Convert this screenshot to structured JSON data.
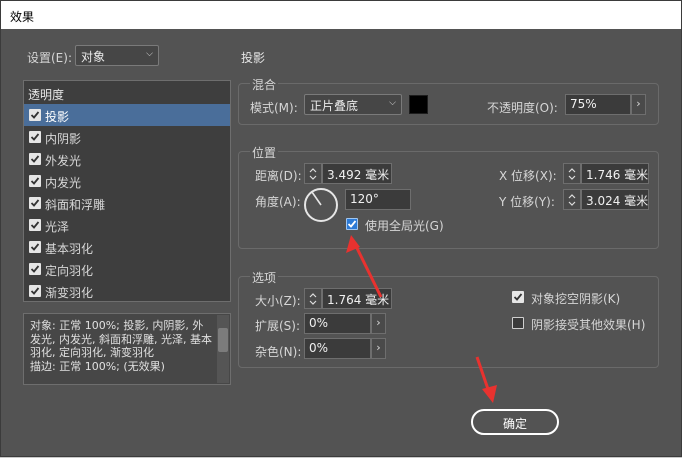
{
  "window": {
    "title": "效果"
  },
  "settings": {
    "label": "设置(E):",
    "value": "对象"
  },
  "left": {
    "header": "透明度",
    "items": [
      {
        "label": "投影",
        "checked": true,
        "selected": true
      },
      {
        "label": "内阴影",
        "checked": true
      },
      {
        "label": "外发光",
        "checked": true
      },
      {
        "label": "内发光",
        "checked": true
      },
      {
        "label": "斜面和浮雕",
        "checked": true
      },
      {
        "label": "光泽",
        "checked": true
      },
      {
        "label": "基本羽化",
        "checked": true
      },
      {
        "label": "定向羽化",
        "checked": true
      },
      {
        "label": "渐变羽化",
        "checked": true
      }
    ],
    "description": "对象: 正常 100%; 投影, 内阴影, 外发光, 内发光, 斜面和浮雕, 光泽, 基本羽化, 定向羽化, 渐变羽化\n描边: 正常 100%; (无效果)"
  },
  "panel": {
    "title": "投影"
  },
  "blend": {
    "title": "混合",
    "mode_label": "模式(M):",
    "mode_value": "正片叠底",
    "color": "#000000",
    "opacity_label": "不透明度(O):",
    "opacity_value": "75%"
  },
  "position": {
    "title": "位置",
    "distance_label": "距离(D):",
    "distance_value": "3.492 毫米",
    "angle_label": "角度(A):",
    "angle_value": "120°",
    "global_light_label": "使用全局光(G)",
    "x_label": "X 位移(X):",
    "x_value": "1.746 毫米",
    "y_label": "Y 位移(Y):",
    "y_value": "3.024 毫米"
  },
  "options": {
    "title": "选项",
    "size_label": "大小(Z):",
    "size_value": "1.764 毫米",
    "spread_label": "扩展(S):",
    "spread_value": "0%",
    "noise_label": "杂色(N):",
    "noise_value": "0%",
    "knockout_label": "对象挖空阴影(K)",
    "other_effects_label": "阴影接受其他效果(H)"
  },
  "buttons": {
    "ok": "确定"
  },
  "colors": {
    "background": "#535353",
    "field": "#3b3b3b",
    "selection": "#4a6e9a",
    "checkbox_blue": "#2c7ad6",
    "annotation": "#e8322f"
  }
}
